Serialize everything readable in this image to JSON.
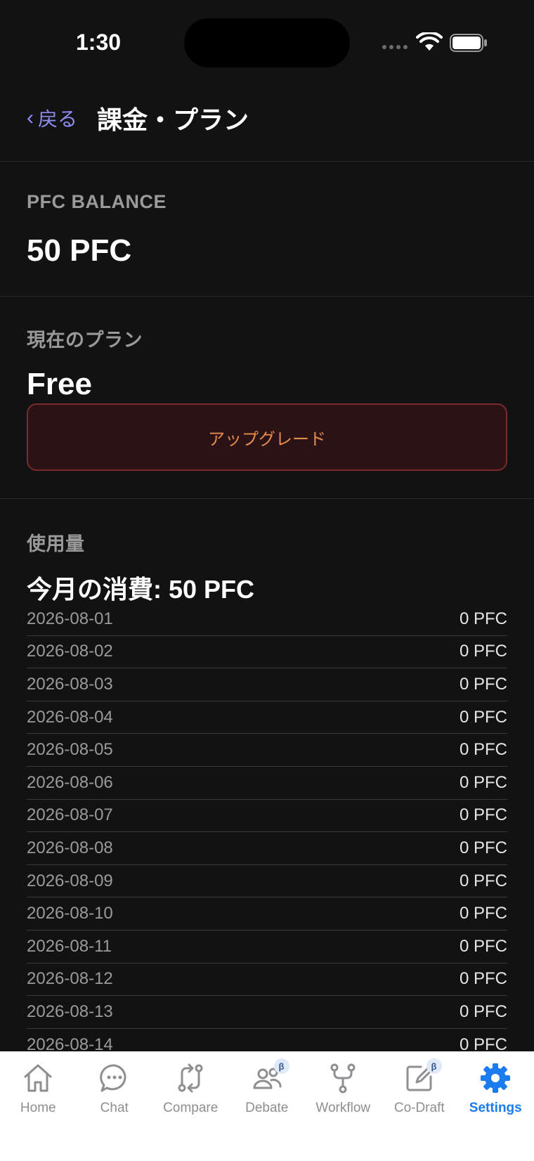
{
  "status_bar": {
    "time": "1:30"
  },
  "header": {
    "back_label": "戻る",
    "title": "課金・プラン"
  },
  "balance": {
    "label": "PFC BALANCE",
    "value": "50 PFC"
  },
  "plan": {
    "label": "現在のプラン",
    "value": "Free",
    "upgrade_label": "アップグレード"
  },
  "usage": {
    "label": "使用量",
    "total": "今月の消費: 50 PFC",
    "rows": [
      {
        "date": "2026-08-01",
        "amount": "0 PFC"
      },
      {
        "date": "2026-08-02",
        "amount": "0 PFC"
      },
      {
        "date": "2026-08-03",
        "amount": "0 PFC"
      },
      {
        "date": "2026-08-04",
        "amount": "0 PFC"
      },
      {
        "date": "2026-08-05",
        "amount": "0 PFC"
      },
      {
        "date": "2026-08-06",
        "amount": "0 PFC"
      },
      {
        "date": "2026-08-07",
        "amount": "0 PFC"
      },
      {
        "date": "2026-08-08",
        "amount": "0 PFC"
      },
      {
        "date": "2026-08-09",
        "amount": "0 PFC"
      },
      {
        "date": "2026-08-10",
        "amount": "0 PFC"
      },
      {
        "date": "2026-08-11",
        "amount": "0 PFC"
      },
      {
        "date": "2026-08-12",
        "amount": "0 PFC"
      },
      {
        "date": "2026-08-13",
        "amount": "0 PFC"
      },
      {
        "date": "2026-08-14",
        "amount": "0 PFC"
      }
    ]
  },
  "tabs": [
    {
      "label": "Home",
      "icon": "house-icon",
      "active": false,
      "beta": false
    },
    {
      "label": "Chat",
      "icon": "chat-bubble-icon",
      "active": false,
      "beta": false
    },
    {
      "label": "Compare",
      "icon": "compare-arrows-icon",
      "active": false,
      "beta": false
    },
    {
      "label": "Debate",
      "icon": "people-icon",
      "active": false,
      "beta": true
    },
    {
      "label": "Workflow",
      "icon": "branch-icon",
      "active": false,
      "beta": false
    },
    {
      "label": "Co-Draft",
      "icon": "edit-square-icon",
      "active": false,
      "beta": true
    },
    {
      "label": "Settings",
      "icon": "gear-icon",
      "active": true,
      "beta": false
    }
  ],
  "beta_symbol": "β",
  "colors": {
    "accent_link": "#8e8cf0",
    "upgrade_text": "#e48b4e",
    "tab_active": "#1a7cf0",
    "tab_inactive": "#8e8e93"
  }
}
